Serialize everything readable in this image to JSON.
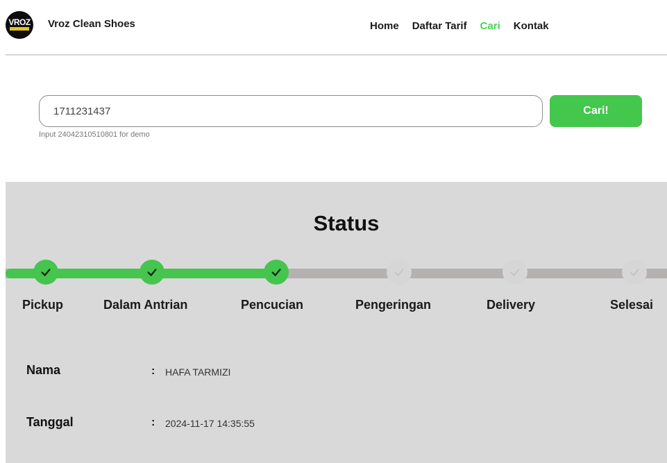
{
  "header": {
    "logo_icon": "vroz-logo",
    "brand": "Vroz Clean Shoes",
    "nav": [
      {
        "label": "Home",
        "active": false
      },
      {
        "label": "Daftar Tarif",
        "active": false
      },
      {
        "label": "Cari",
        "active": true
      },
      {
        "label": "Kontak",
        "active": false
      }
    ],
    "active_color": "#4ccf55"
  },
  "search": {
    "value": "1711231437",
    "button_label": "Cari!",
    "hint": "Input 24042310510801 for demo",
    "button_color": "#43c74c"
  },
  "status": {
    "title": "Status",
    "steps": [
      {
        "label": "Pickup",
        "done": true
      },
      {
        "label": "Dalam Antrian",
        "done": true
      },
      {
        "label": "Pencucian",
        "done": true
      },
      {
        "label": "Pengeringan",
        "done": false
      },
      {
        "label": "Delivery",
        "done": false
      },
      {
        "label": "Selesai",
        "done": false
      }
    ],
    "done_color": "#45c54e",
    "pending_color": "#b5b1b1"
  },
  "info": {
    "nama_label": "Nama",
    "nama_value": "HAFA TARMIZI",
    "tanggal_label": "Tanggal",
    "tanggal_value": "2024-11-17 14:35:55",
    "separator": ":"
  }
}
